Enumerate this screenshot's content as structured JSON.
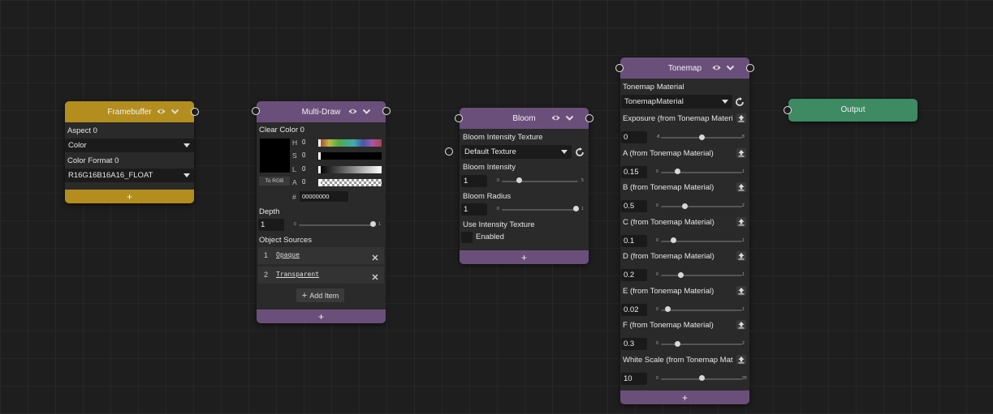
{
  "colors": {
    "framebuffer": "#b38e1e",
    "purple": "#6b4f7b",
    "output": "#3d8a63"
  },
  "framebuffer": {
    "title": "Framebuffer",
    "aspect_label": "Aspect 0",
    "aspect_value": "Color",
    "format_label": "Color Format 0",
    "format_value": "R16G16B16A16_FLOAT",
    "add": "+"
  },
  "multidraw": {
    "title": "Multi-Draw",
    "clear_label": "Clear Color 0",
    "h_label": "H",
    "h_value": "0",
    "s_label": "S",
    "s_value": "0",
    "l_label": "L",
    "l_value": "0",
    "a_label": "A",
    "a_value": "0",
    "to_rgb": "To RGB",
    "hash": "#",
    "hex_value": "00000000",
    "depth_label": "Depth",
    "depth_value": "1",
    "depth_min": "0",
    "depth_max": "1",
    "sources_label": "Object Sources",
    "sources": [
      {
        "index": "1",
        "name": "Opaque"
      },
      {
        "index": "2",
        "name": "Transparent"
      }
    ],
    "add_item": "Add Item",
    "add": "+"
  },
  "bloom": {
    "title": "Bloom",
    "tex_label": "Bloom Intensity Texture",
    "tex_value": "Default Texture",
    "intensity_label": "Bloom Intensity",
    "intensity_value": "1",
    "intensity_min": "0",
    "intensity_max": "5",
    "radius_label": "Bloom Radius",
    "radius_value": "1",
    "radius_min": "0",
    "radius_max": "1",
    "use_label": "Use Intensity Texture",
    "enabled_label": "Enabled",
    "add": "+"
  },
  "tonemap": {
    "title": "Tonemap",
    "material_label": "Tonemap Material",
    "material_value": "TonemapMaterial",
    "params": [
      {
        "label": "Exposure (from Tonemap Materi",
        "value": "0",
        "min": "-8",
        "max": "8",
        "pos": 0.5
      },
      {
        "label": "A (from Tonemap Material)",
        "value": "0.15",
        "min": "0",
        "max": "1",
        "pos": 0.2
      },
      {
        "label": "B (from Tonemap Material)",
        "value": "0.5",
        "min": "0",
        "max": "2",
        "pos": 0.29
      },
      {
        "label": "C (from Tonemap Material)",
        "value": "0.1",
        "min": "0",
        "max": "1",
        "pos": 0.15
      },
      {
        "label": "D (from Tonemap Material)",
        "value": "0.2",
        "min": "0",
        "max": "1",
        "pos": 0.24
      },
      {
        "label": "E (from Tonemap Material)",
        "value": "0.02",
        "min": "0",
        "max": "1",
        "pos": 0.08
      },
      {
        "label": "F (from Tonemap Material)",
        "value": "0.3",
        "min": "0",
        "max": "2",
        "pos": 0.2
      },
      {
        "label": "White Scale (from Tonemap Mat",
        "value": "10",
        "min": "0",
        "max": "20",
        "pos": 0.5
      }
    ],
    "add": "+"
  },
  "output": {
    "title": "Output"
  }
}
